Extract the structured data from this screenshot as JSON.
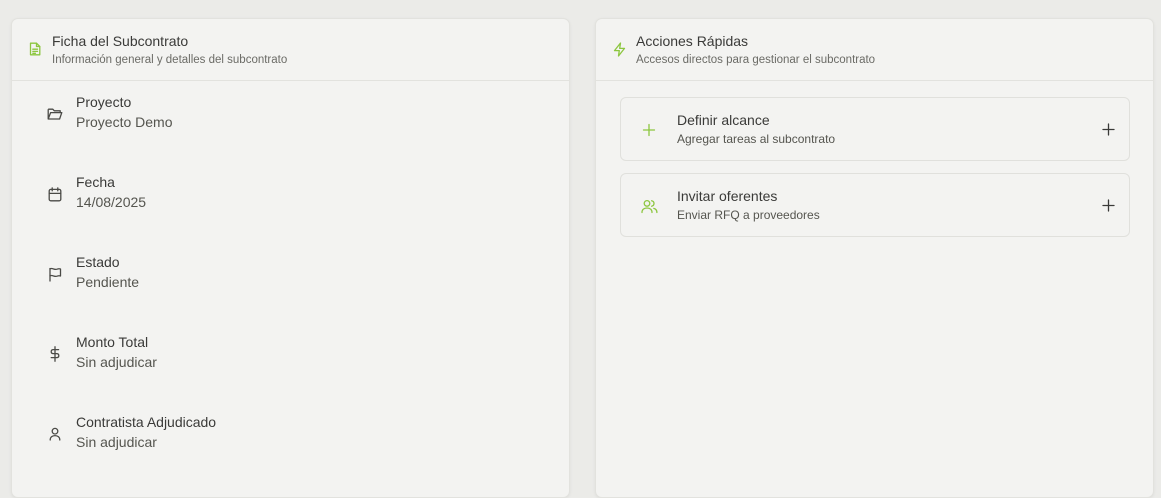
{
  "accent": "#8cc63f",
  "ficha": {
    "title": "Ficha del Subcontrato",
    "subtitle": "Información general y detalles del subcontrato",
    "icon": "document-icon",
    "rows": [
      {
        "icon": "folder-icon",
        "label": "Proyecto",
        "value": "Proyecto Demo"
      },
      {
        "icon": "calendar-icon",
        "label": "Fecha",
        "value": "14/08/2025"
      },
      {
        "icon": "flag-icon",
        "label": "Estado",
        "value": "Pendiente"
      },
      {
        "icon": "dollar-icon",
        "label": "Monto Total",
        "value": "Sin adjudicar"
      },
      {
        "icon": "user-icon",
        "label": "Contratista Adjudicado",
        "value": "Sin adjudicar"
      }
    ]
  },
  "acciones": {
    "title": "Acciones Rápidas",
    "subtitle": "Accesos directos para gestionar el subcontrato",
    "icon": "lightning-icon",
    "items": [
      {
        "icon": "plus-icon",
        "title": "Definir alcance",
        "subtitle": "Agregar tareas al subcontrato",
        "trailing_icon": "plus-icon"
      },
      {
        "icon": "users-icon",
        "title": "Invitar oferentes",
        "subtitle": "Enviar RFQ a proveedores",
        "trailing_icon": "plus-icon"
      }
    ]
  }
}
